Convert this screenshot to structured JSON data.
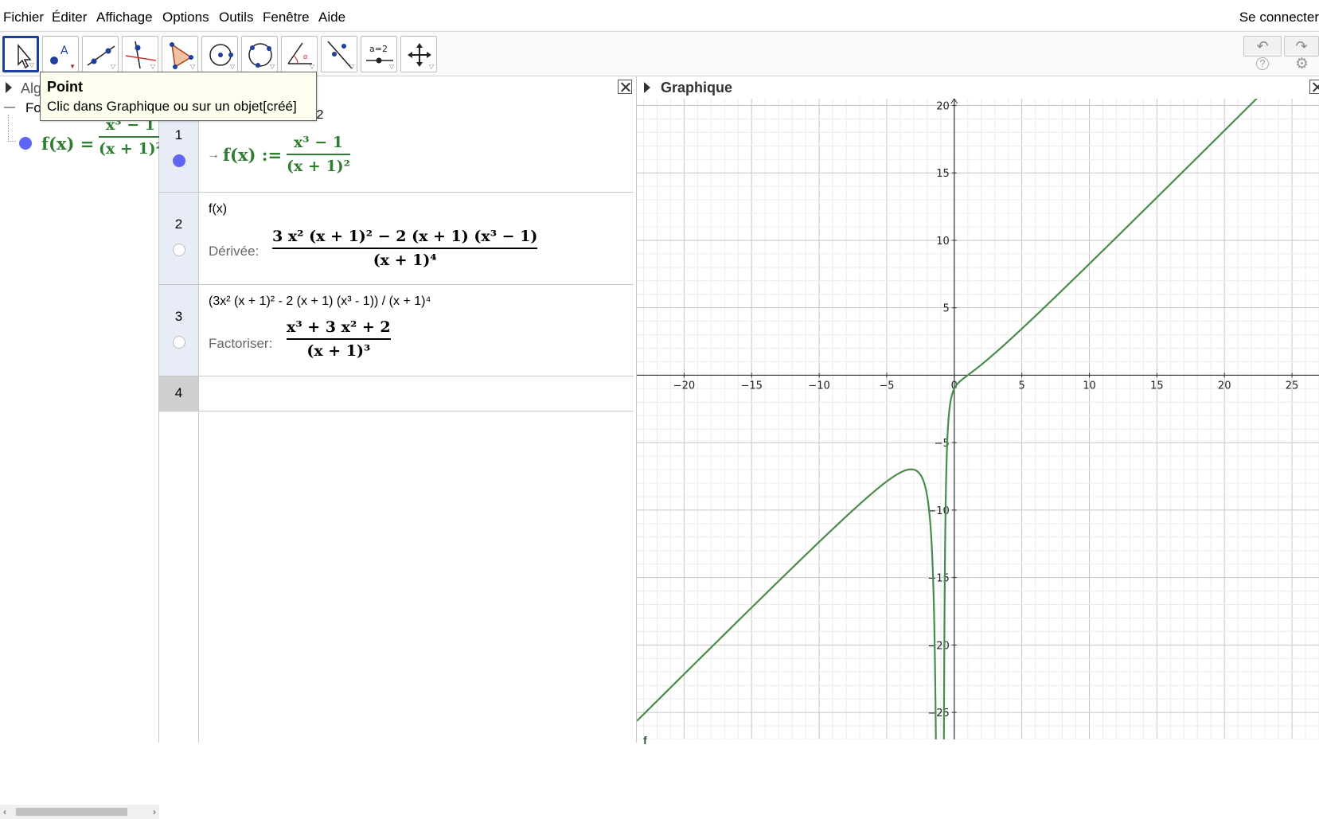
{
  "menu": {
    "items": [
      "Fichier",
      "Éditer",
      "Affichage",
      "Options",
      "Outils",
      "Fenêtre",
      "Aide"
    ],
    "signin": "Se connecter"
  },
  "toolbar": {
    "tools": [
      "move-tool",
      "point-tool",
      "line-tool",
      "perpendicular-tool",
      "polygon-tool",
      "circle-tool",
      "circle-three-points-tool",
      "angle-tool",
      "reflect-tool",
      "slider-tool",
      "move-graphics-tool"
    ],
    "slider_label": "a=2",
    "undo": "↶",
    "redo": "↷",
    "help": "?",
    "settings": "⚙"
  },
  "tooltip": {
    "title": "Point",
    "text": "Clic dans Graphique ou sur un objet[créé]"
  },
  "algebra": {
    "header": "Alg",
    "folder": "Fo",
    "item": {
      "lhs": "f(x) = ",
      "num": "x³ − 1",
      "den": "(x + 1)²"
    }
  },
  "cas": {
    "rows": [
      {
        "num": "1",
        "input": "^2",
        "arrow": "→",
        "lhs": "f(x) :=",
        "frac_num": "x³ − 1",
        "frac_den": "(x + 1)²"
      },
      {
        "num": "2",
        "input": "f(x)",
        "label": "Dérivée:",
        "frac_num": "3 x²  (x + 1)² − 2  (x + 1)  (x³ − 1)",
        "frac_den": "(x + 1)⁴"
      },
      {
        "num": "3",
        "input": "(3x² (x + 1)² - 2 (x + 1) (x³ - 1)) / (x + 1)⁴",
        "label": "Factoriser:",
        "frac_num": "x³ + 3 x² + 2",
        "frac_den": "(x + 1)³"
      },
      {
        "num": "4",
        "input": ""
      }
    ]
  },
  "graphics": {
    "title": "Graphique",
    "curve_label": "f"
  },
  "chart_data": {
    "type": "line",
    "function": "f(x) = (x^3 - 1)/(x + 1)^2",
    "xlim": [
      -23.5,
      27
    ],
    "ylim": [
      -27,
      20.5
    ],
    "x_ticks": [
      -20,
      -15,
      -10,
      -5,
      0,
      5,
      10,
      15,
      20,
      25
    ],
    "y_ticks": [
      -25,
      -20,
      -15,
      -10,
      -5,
      5,
      10,
      15,
      20
    ],
    "series": [
      {
        "color": "#4a8c4a",
        "points": [
          [
            -23.5,
            -25.6
          ],
          [
            -20,
            -22.2
          ],
          [
            -15,
            -17.2
          ],
          [
            -10,
            -12.4
          ],
          [
            -5,
            -7.8
          ],
          [
            -3,
            -7.0
          ],
          [
            -2,
            -9
          ],
          [
            -1.5,
            -17.5
          ],
          [
            -1.2,
            -68
          ],
          [
            -0.8,
            -38
          ],
          [
            -0.5,
            -4.5
          ],
          [
            0,
            -1
          ],
          [
            1,
            0
          ],
          [
            5,
            3.44
          ],
          [
            10,
            8.26
          ],
          [
            15,
            13.18
          ],
          [
            20,
            18.14
          ],
          [
            22.8,
            20.5
          ]
        ]
      }
    ],
    "grid": true
  }
}
